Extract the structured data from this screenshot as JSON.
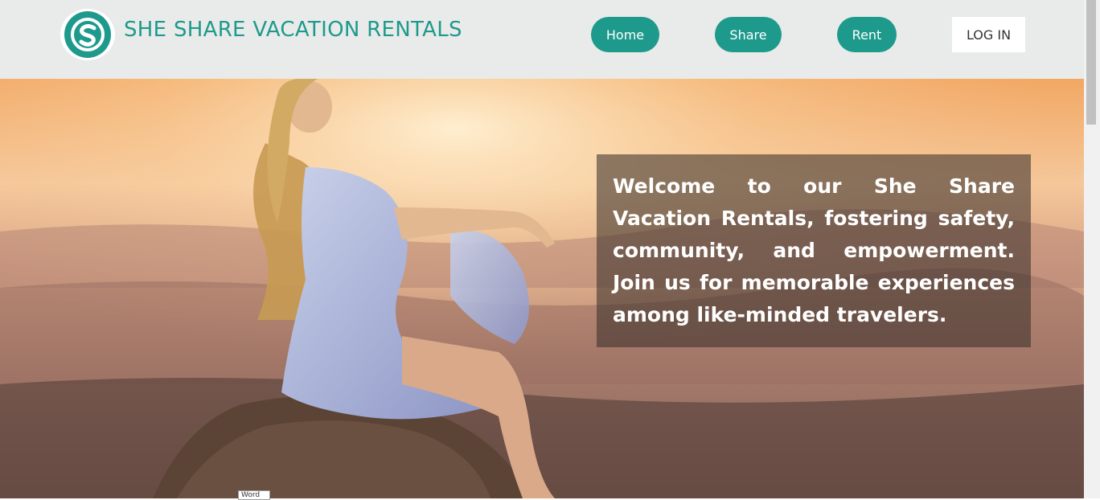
{
  "header": {
    "brand": "SHE SHARE VACATION RENTALS",
    "nav": [
      {
        "label": "Home"
      },
      {
        "label": "Share"
      },
      {
        "label": "Rent"
      }
    ],
    "login_label": "LOG IN"
  },
  "hero": {
    "welcome": "Welcome to our She Share Vacation Rentals, fostering safety, community, and empowerment. Join us for memorable experiences among like-minded travelers."
  },
  "tooltip": "Word",
  "colors": {
    "accent": "#1e9a8c",
    "header_bg": "#e9ebea"
  }
}
